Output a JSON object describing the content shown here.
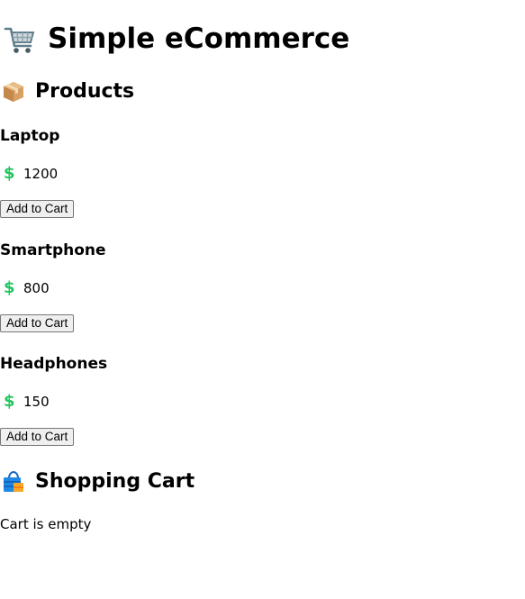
{
  "header": {
    "title": "Simple eCommerce",
    "icon": "shopping-cart-icon"
  },
  "products_section": {
    "title": "Products",
    "icon": "package-icon",
    "items": [
      {
        "name": "Laptop",
        "price": "1200",
        "button_label": "Add to Cart"
      },
      {
        "name": "Smartphone",
        "price": "800",
        "button_label": "Add to Cart"
      },
      {
        "name": "Headphones",
        "price": "150",
        "button_label": "Add to Cart"
      }
    ],
    "price_icon": "dollar-icon"
  },
  "cart_section": {
    "title": "Shopping Cart",
    "icon": "shopping-bag-icon",
    "status": "Cart is empty"
  },
  "colors": {
    "price_icon": "#22c55e",
    "button_bg": "#efefef",
    "button_border": "#767676"
  }
}
